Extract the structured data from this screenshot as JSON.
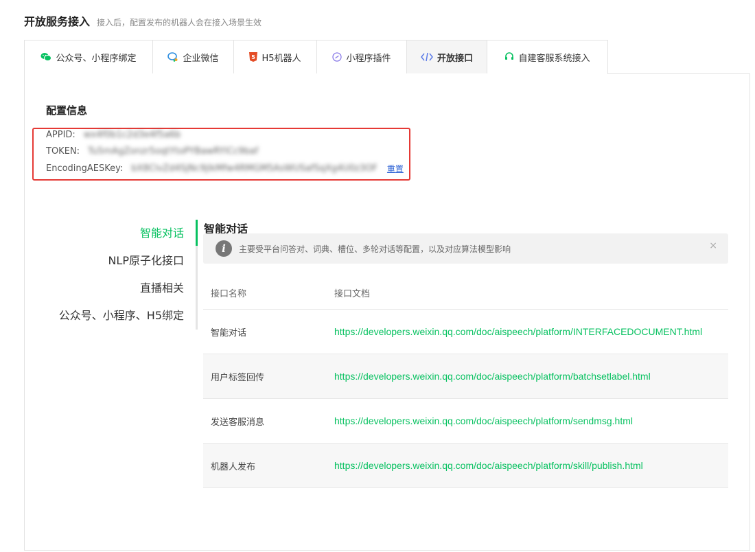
{
  "header": {
    "title": "开放服务接入",
    "subtitle": "接入后，配置发布的机器人会在接入场景生效"
  },
  "tabs": [
    {
      "label": "公众号、小程序绑定",
      "icon": "wechat-icon"
    },
    {
      "label": "企业微信",
      "icon": "wecom-icon"
    },
    {
      "label": "H5机器人",
      "icon": "html5-icon"
    },
    {
      "label": "小程序插件",
      "icon": "miniprogram-icon"
    },
    {
      "label": "开放接口",
      "icon": "code-icon",
      "active": true
    },
    {
      "label": "自建客服系统接入",
      "icon": "headset-icon"
    }
  ],
  "config": {
    "title": "配置信息",
    "appid_label": "APPID:",
    "appid_value": "wx4f0b1c2d3e4f5a6b",
    "token_label": "TOKEN:",
    "token_value": "Tu5mAgZonzr5oqtYtoPYBawRYlCc9baf",
    "aes_label": "EncodingAESKey:",
    "aes_value": "bX8ClvZd4SjNc9jlkMfw4RMGM5AsWUSafSqXg4U0z3OF",
    "reset_label": "重置"
  },
  "sidebar": {
    "items": [
      {
        "label": "智能对话",
        "active": true
      },
      {
        "label": "NLP原子化接口"
      },
      {
        "label": "直播相关"
      },
      {
        "label": "公众号、小程序、H5绑定"
      }
    ]
  },
  "main": {
    "title": "智能对话",
    "notice": "主要受平台问答对、词典、槽位、多轮对话等配置，以及对应算法模型影响",
    "close": "×",
    "table": {
      "headers": [
        "接口名称",
        "接口文档"
      ],
      "rows": [
        {
          "name": "智能对话",
          "url": "https://developers.weixin.qq.com/doc/aispeech/platform/INTERFACEDOCUMENT.html"
        },
        {
          "name": "用户标签回传",
          "url": "https://developers.weixin.qq.com/doc/aispeech/platform/batchsetlabel.html"
        },
        {
          "name": "发送客服消息",
          "url": "https://developers.weixin.qq.com/doc/aispeech/platform/sendmsg.html"
        },
        {
          "name": "机器人发布",
          "url": "https://developers.weixin.qq.com/doc/aispeech/platform/skill/publish.html"
        }
      ]
    }
  },
  "colors": {
    "accent": "#07c160",
    "highlight_border": "#e53935",
    "link": "#3367d6"
  }
}
